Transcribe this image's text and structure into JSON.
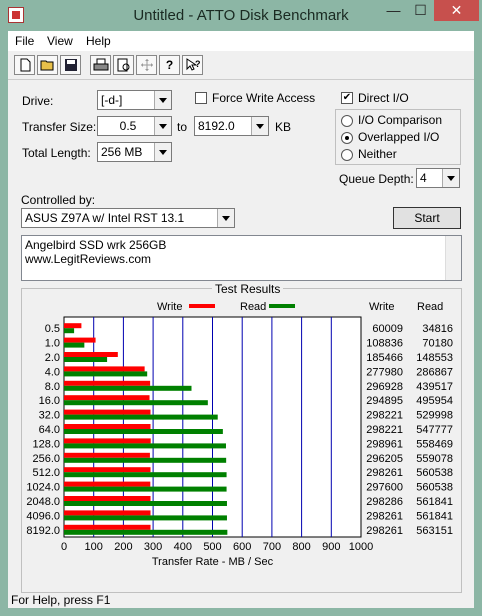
{
  "window": {
    "title": "Untitled - ATTO Disk Benchmark",
    "minimize": "—",
    "maximize": "☐",
    "close": "✕"
  },
  "menu": [
    "File",
    "View",
    "Help"
  ],
  "toolbar": [
    "new-icon",
    "open-icon",
    "save-icon",
    "print-icon",
    "print-preview-icon",
    "move-icon",
    "help-icon",
    "context-help-icon"
  ],
  "form": {
    "drive_label": "Drive:",
    "drive_value": "[-d-]",
    "force_write_label": "Force Write Access",
    "direct_io_label": "Direct I/O",
    "direct_io_checked": "✔",
    "transfer_size_label": "Transfer Size:",
    "transfer_from": "0.5",
    "to_label": "to",
    "transfer_to": "8192.0",
    "kb_label": "KB",
    "io_comparison": "I/O Comparison",
    "overlapped_io": "Overlapped I/O",
    "neither": "Neither",
    "total_length_label": "Total Length:",
    "total_length_value": "256 MB",
    "queue_depth_label": "Queue Depth:",
    "queue_depth_value": "4",
    "controlled_by_label": "Controlled by:",
    "controller_value": "ASUS Z97A w/ Intel RST 13.1",
    "start_button": "Start",
    "notes_line1": "Angelbird SSD wrk 256GB",
    "notes_line2": "www.LegitReviews.com"
  },
  "results": {
    "title": "Test Results",
    "write_legend": "Write",
    "read_legend": "Read",
    "write_col": "Write",
    "read_col": "Read"
  },
  "status": {
    "text": "For Help, press F1"
  },
  "colors": {
    "write": "#ff0000",
    "read": "#008000",
    "grid": "#0000b0"
  },
  "chart_data": {
    "type": "bar",
    "xlabel": "Transfer Rate - MB / Sec",
    "xlim": [
      0,
      1000
    ],
    "xticks": [
      "0",
      "100",
      "200",
      "300",
      "400",
      "500",
      "600",
      "700",
      "800",
      "900",
      "1000"
    ],
    "categories": [
      "0.5",
      "1.0",
      "2.0",
      "4.0",
      "8.0",
      "16.0",
      "32.0",
      "64.0",
      "128.0",
      "256.0",
      "512.0",
      "1024.0",
      "2048.0",
      "4096.0",
      "8192.0"
    ],
    "series": [
      {
        "name": "Write",
        "values": [
          58.6,
          106.3,
          181.2,
          271.5,
          290.0,
          288.0,
          291.2,
          291.2,
          291.9,
          289.3,
          291.3,
          290.6,
          291.3,
          291.3,
          291.3
        ]
      },
      {
        "name": "Read",
        "values": [
          34.0,
          68.5,
          145.1,
          280.1,
          429.3,
          484.3,
          517.6,
          534.9,
          545.4,
          546.0,
          547.4,
          547.4,
          548.7,
          548.7,
          550.0
        ]
      }
    ],
    "write_raw": [
      "60009",
      "108836",
      "185466",
      "277980",
      "296928",
      "294895",
      "298221",
      "298221",
      "298961",
      "296205",
      "298261",
      "297600",
      "298286",
      "298261",
      "298261"
    ],
    "read_raw": [
      "34816",
      "70180",
      "148553",
      "286867",
      "439517",
      "495954",
      "529998",
      "547777",
      "558469",
      "559078",
      "560538",
      "560538",
      "561841",
      "561841",
      "563151"
    ]
  }
}
